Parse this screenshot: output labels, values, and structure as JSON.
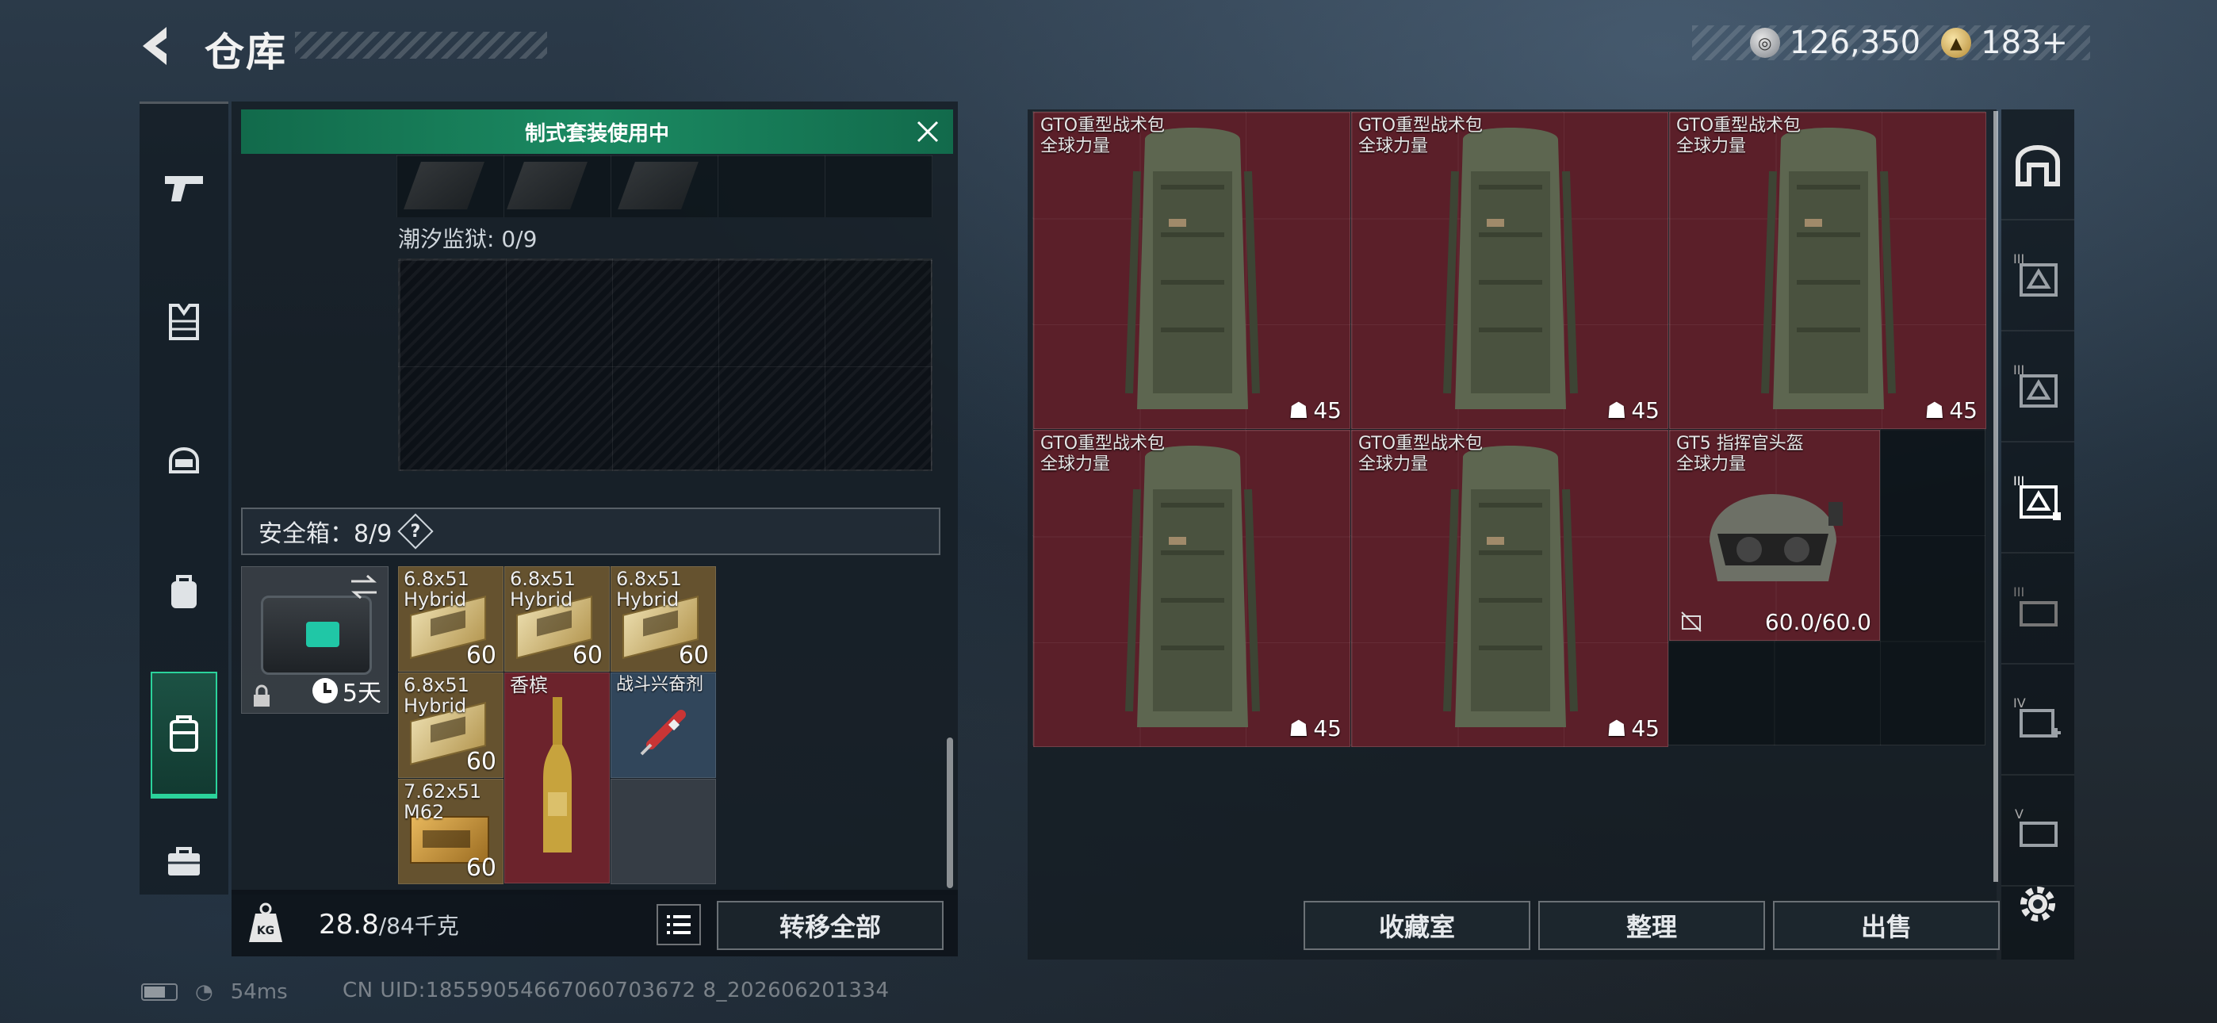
{
  "header": {
    "title": "仓库"
  },
  "currency": [
    {
      "icon": "silver-coin-icon",
      "value": "126,350"
    },
    {
      "icon": "gold-coin-icon",
      "value": "183+"
    }
  ],
  "left_nav": [
    {
      "name": "weapons",
      "icon": "pistol-icon",
      "active": false
    },
    {
      "name": "armor",
      "icon": "vest-icon",
      "active": false
    },
    {
      "name": "helmet",
      "icon": "helmet-icon",
      "active": false
    },
    {
      "name": "backpack",
      "icon": "backpack-icon",
      "active": false
    },
    {
      "name": "safe-box",
      "icon": "safe-box-icon",
      "active": true
    },
    {
      "name": "toolbox",
      "icon": "toolbox-icon",
      "active": false
    }
  ],
  "banner": {
    "text": "制式套装使用中"
  },
  "prison": {
    "label": "潮汐监狱: 0/9"
  },
  "safe": {
    "label": "安全箱：8/9",
    "help": "?",
    "timer": "5天"
  },
  "safe_items": [
    {
      "name": "6.8x51\nHybrid",
      "qty": "60",
      "kind": "ammo"
    },
    {
      "name": "6.8x51\nHybrid",
      "qty": "60",
      "kind": "ammo"
    },
    {
      "name": "6.8x51\nHybrid",
      "qty": "60",
      "kind": "ammo"
    },
    {
      "name": "6.8x51\nHybrid",
      "qty": "60",
      "kind": "ammo"
    },
    {
      "name": "香槟",
      "qty": "",
      "kind": "bottle"
    },
    {
      "name": "战斗兴奋剂",
      "qty": "",
      "kind": "syringe"
    },
    {
      "name": "7.62x51\nM62",
      "qty": "60",
      "kind": "ammo2"
    }
  ],
  "weight": {
    "current": "28.8",
    "max": "/84千克"
  },
  "buttons": {
    "transfer_all": "转移全部",
    "collection": "收藏室",
    "sort": "整理",
    "sell": "出售"
  },
  "stash_items": [
    {
      "name": "GTO重型战术包",
      "brand": "全球力量",
      "value": "45"
    },
    {
      "name": "GTO重型战术包",
      "brand": "全球力量",
      "value": "45"
    },
    {
      "name": "GTO重型战术包",
      "brand": "全球力量",
      "value": "45"
    },
    {
      "name": "GTO重型战术包",
      "brand": "全球力量",
      "value": "45"
    },
    {
      "name": "GTO重型战术包",
      "brand": "全球力量",
      "value": "45"
    },
    {
      "name": "GT5 指挥官头盔",
      "brand": "全球力量",
      "value": "60.0/60.0"
    }
  ],
  "right_nav": [
    {
      "icon": "stash-home-icon",
      "label": ""
    },
    {
      "icon": "stash-page-3-icon",
      "label": "III"
    },
    {
      "icon": "stash-page-3b-icon",
      "label": "III"
    },
    {
      "icon": "stash-page-3-active-icon",
      "label": "III"
    },
    {
      "icon": "stash-page-3c-icon",
      "label": "III"
    },
    {
      "icon": "stash-page-4-icon",
      "label": "IV"
    },
    {
      "icon": "stash-page-5-icon",
      "label": "V"
    }
  ],
  "status": {
    "ping": "54ms",
    "uid": "CN UID:18559054667060703672 8_202606201334"
  },
  "colors": {
    "accent_green": "#1b8a62",
    "item_red": "#5b1f29",
    "active_nav": "#2bd39b"
  }
}
